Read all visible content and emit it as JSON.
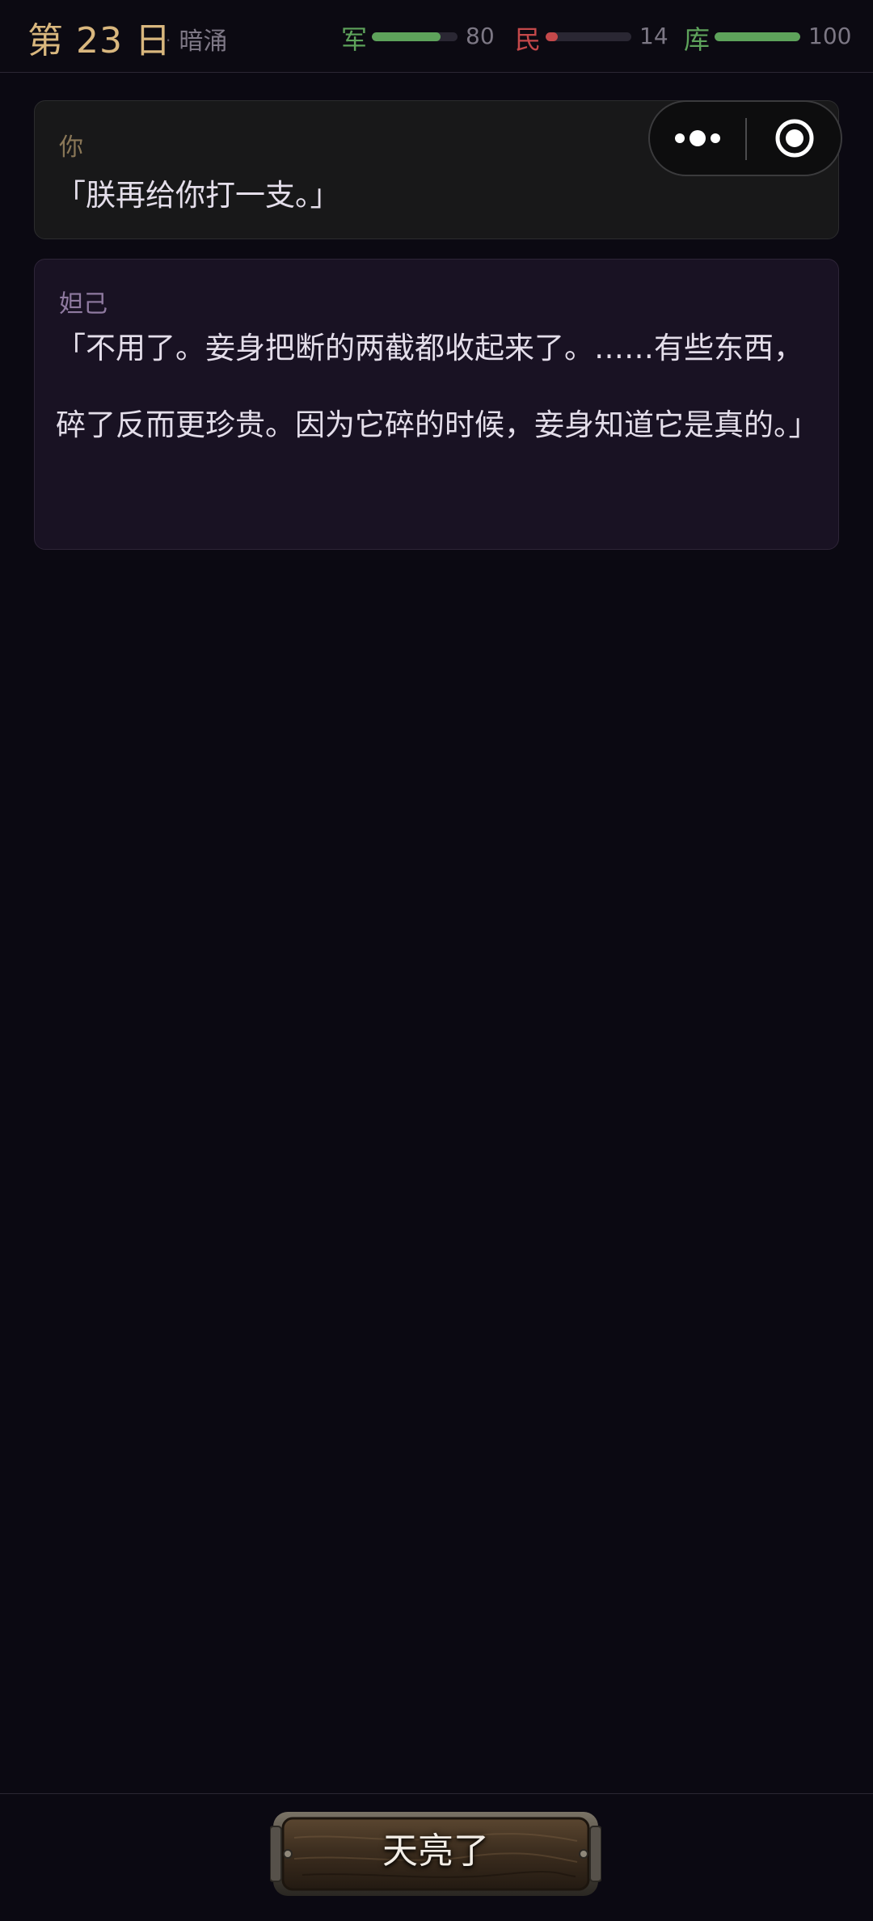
{
  "header": {
    "day": "第 23 日",
    "phase_separator": "·",
    "phase": "暗涌",
    "stats": [
      {
        "label": "军",
        "value": "80",
        "level": 0.8,
        "color": "#5ea35b"
      },
      {
        "label": "民",
        "value": "14",
        "level": 0.14,
        "color": "#c4484a"
      },
      {
        "label": "库",
        "value": "100",
        "level": 1.0,
        "color": "#5ea35b"
      }
    ]
  },
  "dialogue": [
    {
      "speaker": "你",
      "text": "「朕再给你打一支。」"
    },
    {
      "speaker": "妲己",
      "text": "「不用了。妾身把断的两截都收起来了。……有些东西，碎了反而更珍贵。因为它碎的时候，妾身知道它是真的。」"
    }
  ],
  "capsule": {
    "more_icon": "more-dots-icon",
    "close_icon": "target-close-icon"
  },
  "footer": {
    "button_label": "天亮了"
  }
}
